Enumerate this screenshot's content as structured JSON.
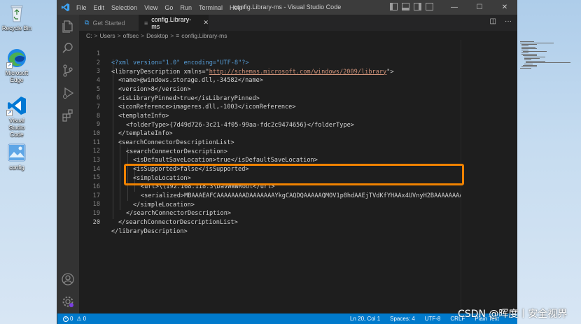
{
  "desktop": {
    "icons": [
      {
        "label": "Recycle Bin"
      },
      {
        "label": "Microsoft Edge"
      },
      {
        "label": "Visual Studio Code"
      },
      {
        "label": "config"
      }
    ]
  },
  "window": {
    "menu": [
      "File",
      "Edit",
      "Selection",
      "View",
      "Go",
      "Run",
      "Terminal",
      "Help"
    ],
    "title": "config.Library-ms - Visual Studio Code",
    "controls": {
      "minimize": "—",
      "maximize": "☐",
      "close": "✕"
    }
  },
  "tabs": [
    {
      "label": "Get Started"
    },
    {
      "label": "config.Library-ms",
      "close": "✕"
    }
  ],
  "tab_actions": {
    "split": "◫",
    "more": "···"
  },
  "breadcrumb": [
    "C:",
    "Users",
    "offsec",
    "Desktop",
    "config.Library-ms"
  ],
  "breadcrumb_sep": ">",
  "editor": {
    "lines": [
      {
        "n": "1"
      },
      {
        "n": "2"
      },
      {
        "n": "3"
      },
      {
        "n": "4"
      },
      {
        "n": "5"
      },
      {
        "n": "6"
      },
      {
        "n": "7"
      },
      {
        "n": "8"
      },
      {
        "n": "9"
      },
      {
        "n": "10"
      },
      {
        "n": "11"
      },
      {
        "n": "12"
      },
      {
        "n": "13"
      },
      {
        "n": "14"
      },
      {
        "n": "15"
      },
      {
        "n": "16"
      },
      {
        "n": "17"
      },
      {
        "n": "18"
      },
      {
        "n": "19"
      },
      {
        "n": "20"
      }
    ],
    "tokens": {
      "l1": "<?xml version=\"1.0\" encoding=\"UTF-8\"?>",
      "l2a": "<libraryDescription xmlns=\"",
      "l2url": "http://schemas.microsoft.com/windows/2009/library",
      "l2b": "\">",
      "l3a": "<name>",
      "l3v": "@windows.storage.dll,-34582",
      "l3b": "</name>",
      "l4a": "<version>",
      "l4v": "8",
      "l4b": "</version>",
      "l5a": "<isLibraryPinned>",
      "l5v": "true",
      "l5b": "</isLibraryPinned>",
      "l6a": "<iconReference>",
      "l6v": "imageres.dll,-1003",
      "l6b": "</iconReference>",
      "l7": "<templateInfo>",
      "l8a": "<folderType>",
      "l8v": "{7d49d726-3c21-4f05-99aa-fdc2c9474656}",
      "l8b": "</folderType>",
      "l9": "</templateInfo>",
      "l10": "<searchConnectorDescriptionList>",
      "l11": "<searchConnectorDescription>",
      "l12a": "<isDefaultSaveLocation>",
      "l12v": "true",
      "l12b": "</isDefaultSaveLocation>",
      "l13a": "<isSupported>",
      "l13v": "false",
      "l13b": "</isSupported>",
      "l14": "<simpleLocation>",
      "l15a": "<url>",
      "l15v": "\\\\192.168.118.3\\DavWWWRoot",
      "l15b": "</url>",
      "l16a": "<serialized>",
      "l16v": "MBAAAEAFCAAAAAAAADAAAAAAAYkgCAQDQAAAAAQMOV1p8hdAAEjTVdKfYHAAx4UVnyH2BAAAAAAAA",
      "l17": "</simpleLocation>",
      "l18": "</searchConnectorDescription>",
      "l19": "</searchConnectorDescriptionList>",
      "l20": "</libraryDescription>"
    }
  },
  "statusbar": {
    "errors": "0",
    "warnings": "0",
    "position": "Ln 20, Col 1",
    "spaces": "Spaces: 4",
    "encoding": "UTF-8",
    "eol": "CRLF",
    "language": "Plain Text"
  },
  "watermark": "CSDN @晖度丨安全视界",
  "colors": {
    "highlight": "#f08200",
    "statusbar": "#007acc",
    "tag": "#569cd6",
    "string": "#ce9178"
  }
}
